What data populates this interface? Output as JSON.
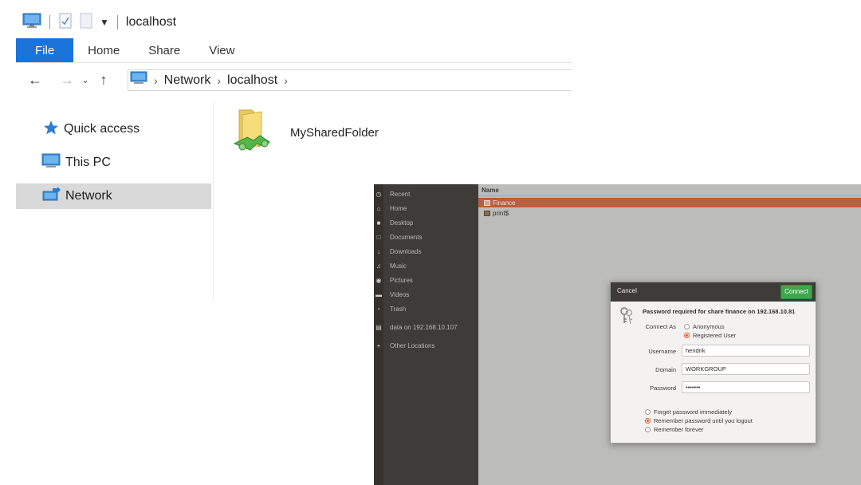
{
  "explorer": {
    "title": "localhost",
    "ribbon_tabs": [
      "File",
      "Home",
      "Share",
      "View"
    ],
    "breadcrumb": [
      "Network",
      "localhost"
    ],
    "nav": [
      {
        "label": "Quick access",
        "icon": "star-icon"
      },
      {
        "label": "This PC",
        "icon": "computer-icon"
      },
      {
        "label": "Network",
        "icon": "network-icon",
        "selected": true
      }
    ],
    "items": [
      {
        "label": "MySharedFolder",
        "icon": "shared-folder-icon"
      }
    ],
    "colors": {
      "file_tab": "#1a73d9",
      "selected_nav": "#d9d9d9"
    }
  },
  "nautilus": {
    "sidebar": [
      {
        "label": "Recent",
        "icon": "clock-icon"
      },
      {
        "label": "Home",
        "icon": "home-icon"
      },
      {
        "label": "Desktop",
        "icon": "desktop-icon"
      },
      {
        "label": "Documents",
        "icon": "document-icon"
      },
      {
        "label": "Downloads",
        "icon": "download-icon"
      },
      {
        "label": "Music",
        "icon": "music-icon"
      },
      {
        "label": "Pictures",
        "icon": "camera-icon"
      },
      {
        "label": "Videos",
        "icon": "video-icon"
      },
      {
        "label": "Trash",
        "icon": "trash-icon"
      },
      {
        "label": "data on 192.168.10.107",
        "icon": "drive-icon"
      },
      {
        "label": "Other Locations",
        "icon": "plus-icon"
      }
    ],
    "list_header": "Name",
    "rows": [
      {
        "label": "Finance",
        "selected": true
      },
      {
        "label": "print$",
        "selected": false
      }
    ],
    "colors": {
      "selected_row": "#b75f3e",
      "connect_button": "#3fa64c",
      "sidebar": "#3e3b38"
    }
  },
  "dialog": {
    "cancel_label": "Cancel",
    "connect_label": "Connect",
    "title": "Password required for share finance on 192.168.10.81",
    "connect_as_label": "Connect As",
    "connect_as_options": [
      "Anonymous",
      "Registered User"
    ],
    "connect_as_selected": "Registered User",
    "username_label": "Username",
    "username_value": "hendrik",
    "domain_label": "Domain",
    "domain_value": "WORKGROUP",
    "password_label": "Password",
    "password_value": "•••••••",
    "remember_options": [
      "Forget password immediately",
      "Remember password until you logout",
      "Remember forever"
    ],
    "remember_selected": "Remember password until you logout"
  }
}
